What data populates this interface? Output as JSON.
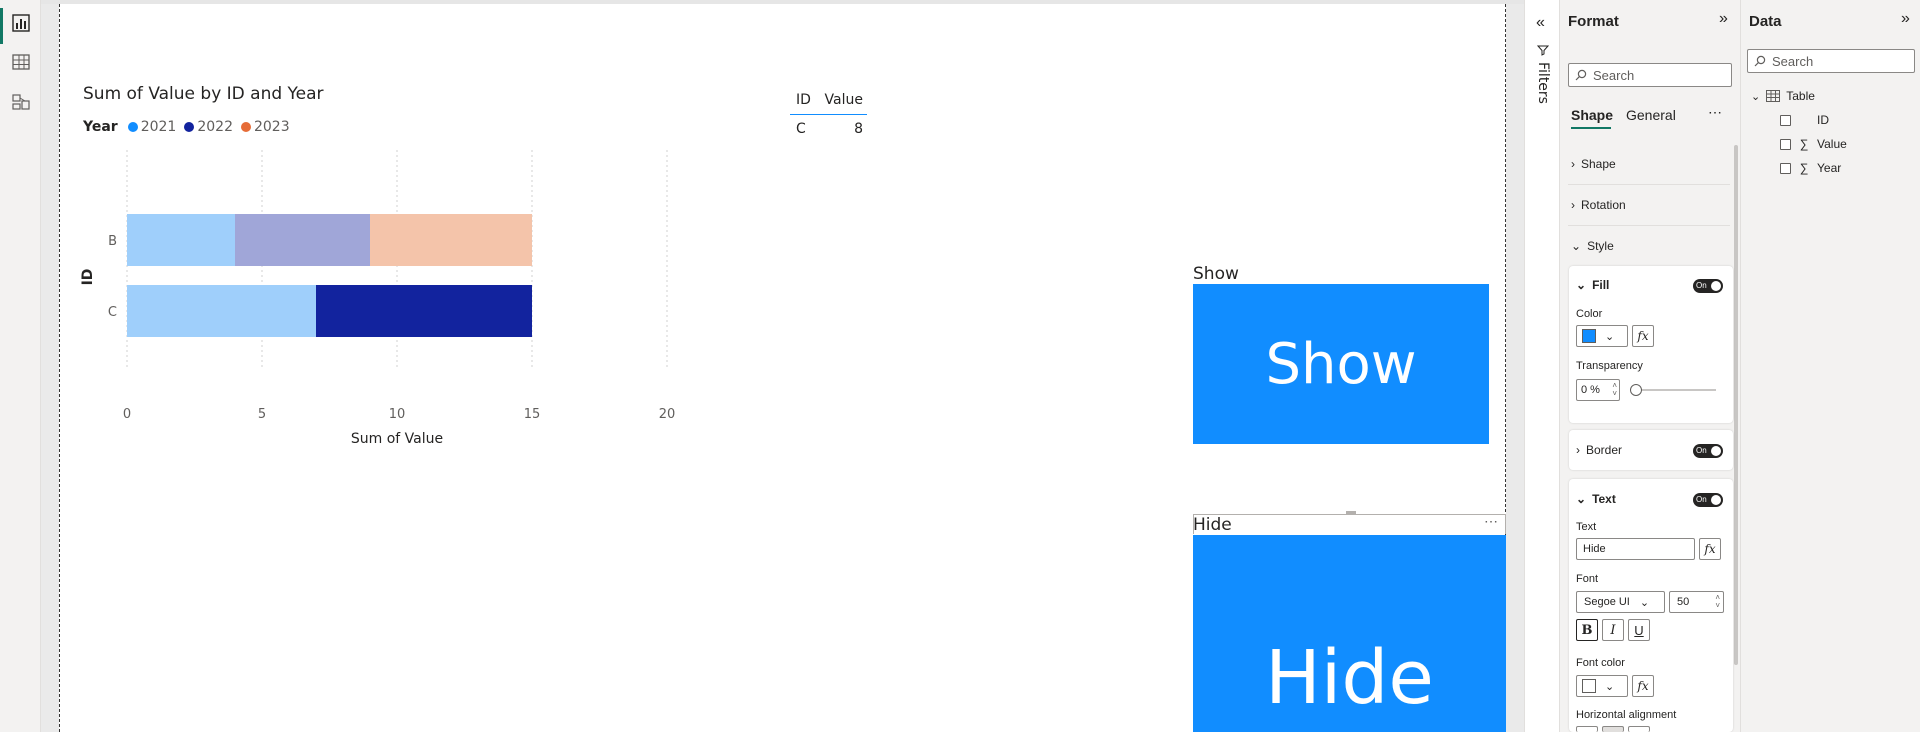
{
  "chart": {
    "title": "Sum of Value by ID and Year",
    "legend_title": "Year",
    "legend": [
      {
        "name": "2021",
        "color": "#118dff"
      },
      {
        "name": "2022",
        "color": "#12239e"
      },
      {
        "name": "2023",
        "color": "#e66c37"
      }
    ],
    "xlabel": "Sum of Value",
    "ylabel": "ID"
  },
  "chart_data": {
    "type": "bar",
    "orientation": "horizontal",
    "stacked": true,
    "title": "Sum of Value by ID and Year",
    "xlabel": "Sum of Value",
    "ylabel": "ID",
    "categories": [
      "B",
      "C"
    ],
    "series": [
      {
        "name": "2021",
        "values": [
          4,
          7
        ],
        "color": "#9fcffb",
        "highlight_color": "#118dff"
      },
      {
        "name": "2022",
        "values": [
          5,
          8
        ],
        "color": "#a0a6d8",
        "highlight_color": "#12239e"
      },
      {
        "name": "2023",
        "values": [
          6,
          0
        ],
        "color": "#f4c4aa",
        "highlight_color": "#e66c37"
      }
    ],
    "highlighted": [
      {
        "category": "C",
        "series": "2022"
      }
    ],
    "xlim": [
      0,
      20
    ],
    "xticks": [
      "0",
      "5",
      "10",
      "15",
      "20"
    ],
    "grid": true,
    "legend_position": "top-left"
  },
  "table_visual": {
    "headers": [
      "ID",
      "Value"
    ],
    "rows": [
      [
        "C",
        "8"
      ]
    ]
  },
  "show_button": {
    "header": "Show",
    "label": "Show"
  },
  "hide_button": {
    "header": "Hide",
    "label": "Hide"
  },
  "filters": {
    "label": "Filters"
  },
  "format_pane": {
    "title": "Format",
    "search_placeholder": "Search",
    "tabs": [
      "Shape",
      "General"
    ],
    "more": "⋯",
    "sections": {
      "shape": "Shape",
      "rotation": "Rotation",
      "style": "Style"
    },
    "fill": {
      "title": "Fill",
      "toggle": "On",
      "color_label": "Color",
      "color_value": "#118dff",
      "fx": "fx",
      "transparency_label": "Transparency",
      "transparency_value": "0 %",
      "transparency_level": 0
    },
    "border": {
      "title": "Border",
      "toggle": "On"
    },
    "text": {
      "title": "Text",
      "toggle": "On",
      "text_label": "Text",
      "text_value": "Hide",
      "fx": "fx",
      "font_label": "Font",
      "font_value": "Segoe UI",
      "font_size": "50",
      "bold": "B",
      "italic": "I",
      "underline": "U",
      "font_color_label": "Font color",
      "h_align_label": "Horizontal alignment"
    }
  },
  "data_pane": {
    "title": "Data",
    "search_placeholder": "Search",
    "table_name": "Table",
    "fields": [
      {
        "name": "ID",
        "sigma": false
      },
      {
        "name": "Value",
        "sigma": true
      },
      {
        "name": "Year",
        "sigma": true
      }
    ]
  }
}
